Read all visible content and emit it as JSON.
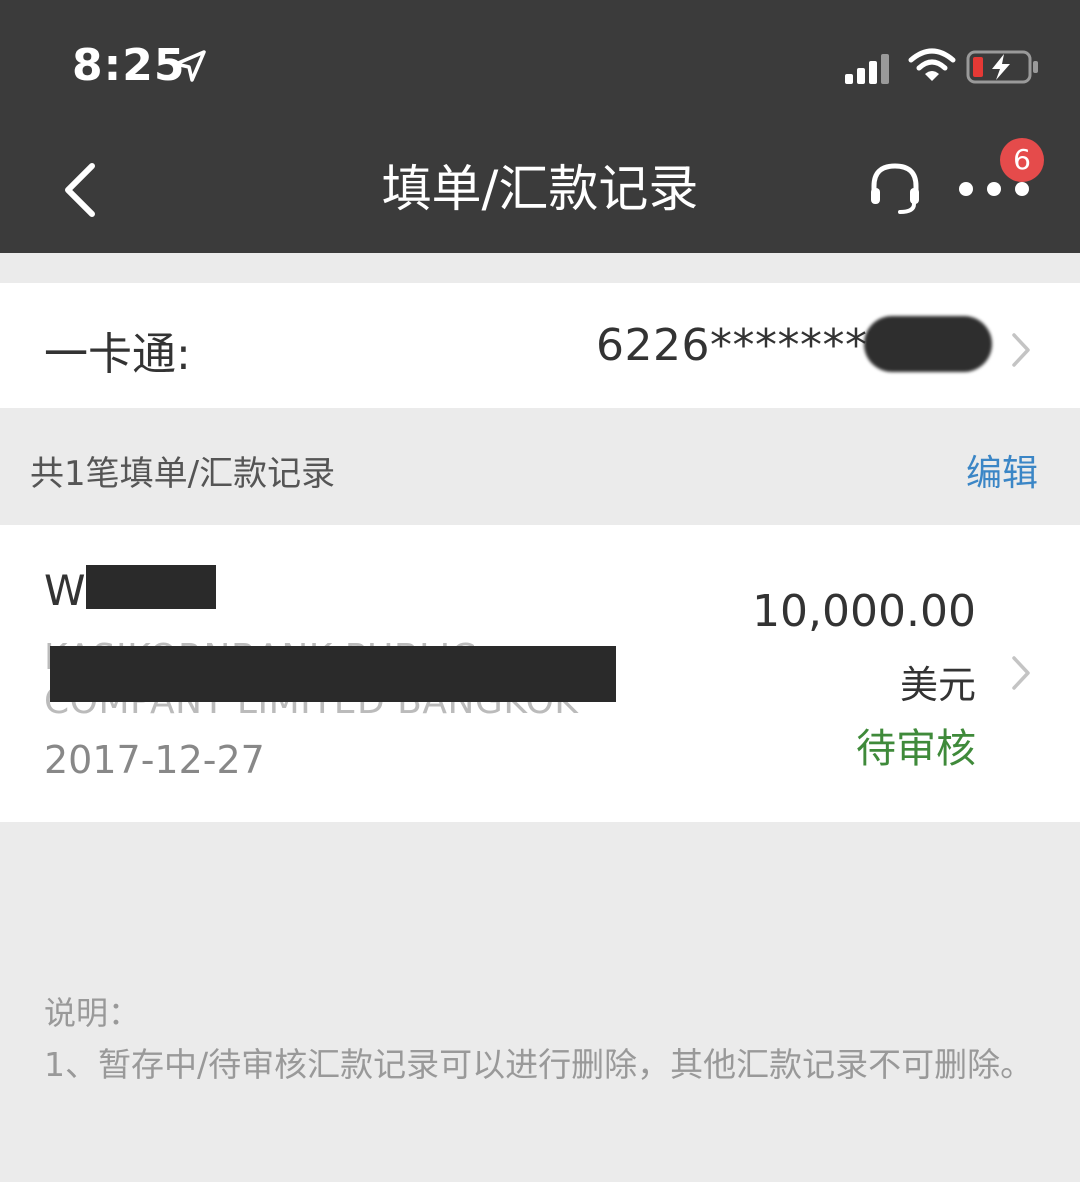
{
  "status_bar": {
    "time": "8:25",
    "icons": [
      "location-arrow-icon",
      "cellular-signal-icon",
      "wifi-icon",
      "battery-charging-icon"
    ]
  },
  "nav": {
    "title": "填单/汇款记录",
    "back_icon": "chevron-left-icon",
    "service_icon": "headset-icon",
    "more_icon": "more-dots-icon",
    "badge_count": "6",
    "badge_color": "#e54b4b"
  },
  "card": {
    "label": "一卡通:",
    "number": "6226********"
  },
  "records_section": {
    "count_text": "共1笔填单/汇款记录",
    "edit_label": "编辑"
  },
  "records": [
    {
      "name": "W",
      "bank": "KASIKORNBANK PUBLIC COMPANY LIMITED BANGKOK",
      "date": "2017-12-27",
      "amount": "10,000.00",
      "currency": "美元",
      "status": "待审核",
      "status_color": "#3f8a3a"
    }
  ],
  "notes": {
    "title": "说明：",
    "items": [
      "1、暂存中/待审核汇款记录可以进行删除，其他汇款记录不可删除。"
    ]
  },
  "colors": {
    "header_bg": "#3b3b3b",
    "page_bg": "#ebebeb",
    "link": "#3b86c6"
  }
}
